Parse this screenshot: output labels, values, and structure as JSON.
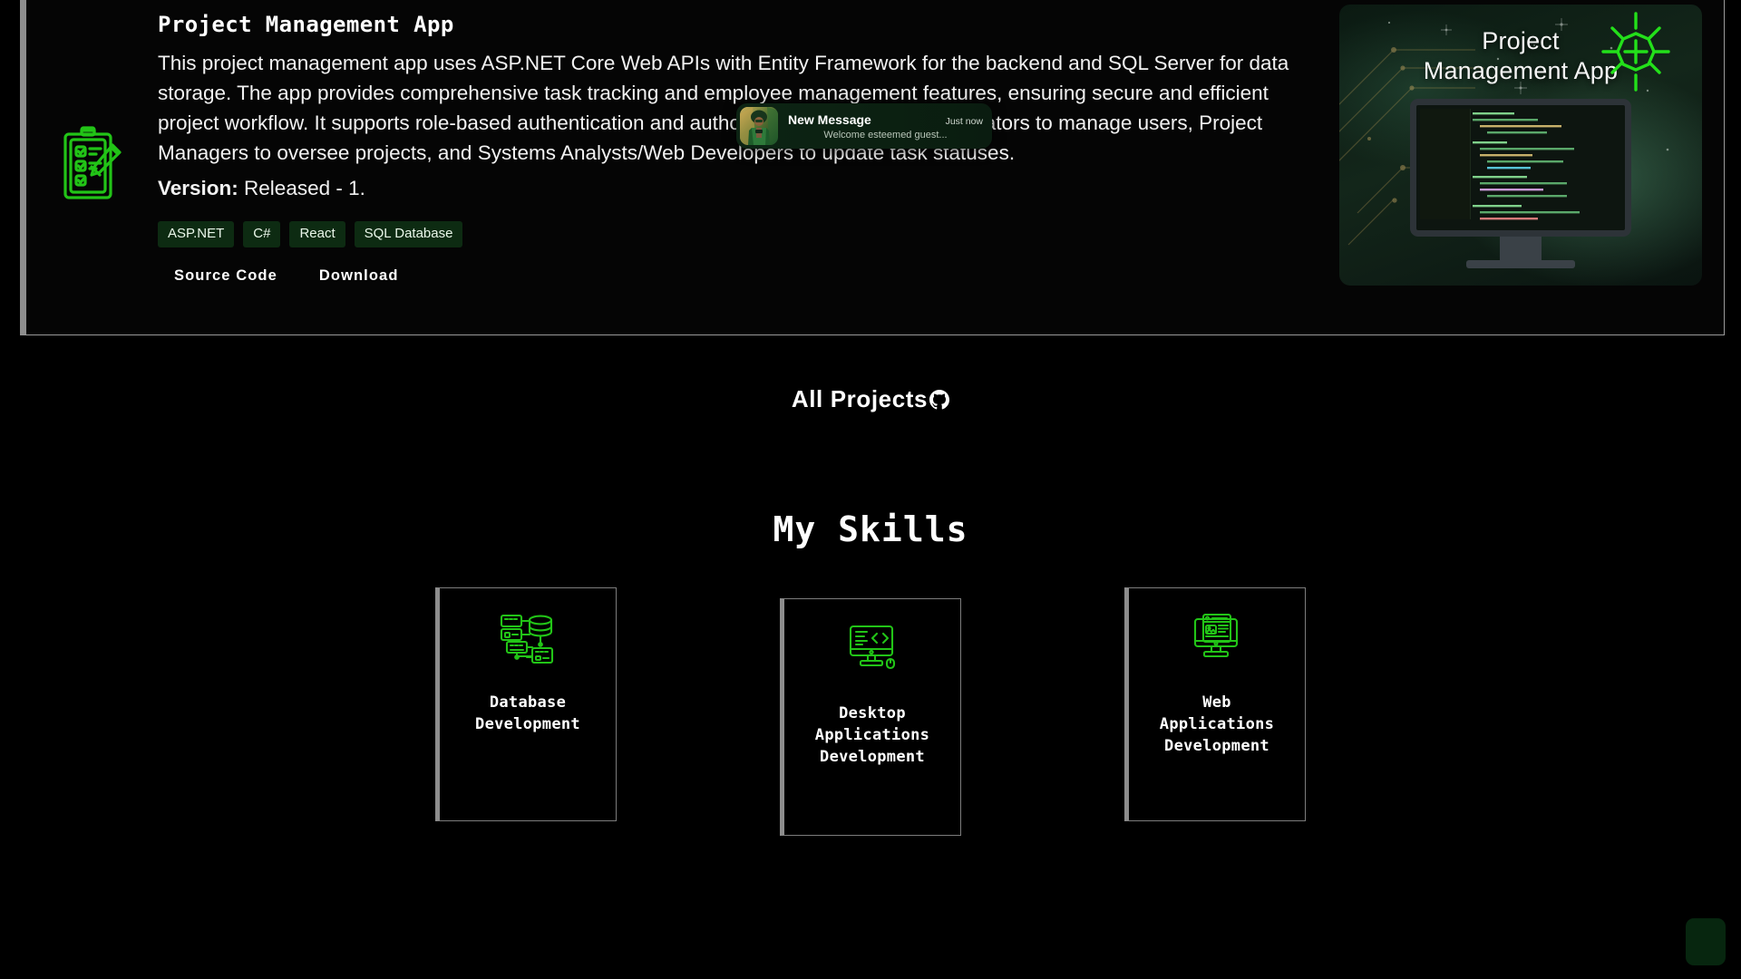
{
  "project": {
    "title": "Project Management App",
    "description": "This project management app uses ASP.NET Core Web APIs with Entity Framework for the backend and SQL Server for data storage. The app provides comprehensive task tracking and employee management features, ensuring secure and efficient project workflow. It supports role-based authentication and authorization, enabling Administrators to manage users, Project Managers to oversee projects, and Systems Analysts/Web Developers to update task statuses.",
    "version_label": "Version:",
    "version_value": "Released - 1.",
    "tags": [
      "ASP.NET",
      "C#",
      "React",
      "SQL Database"
    ],
    "links": [
      {
        "label": "Source Code"
      },
      {
        "label": "Download"
      }
    ],
    "icon_name": "clipboard-checklist-icon",
    "image": {
      "overlay_title_line1": "Project",
      "overlay_title_line2": "Management App",
      "sun_icon_name": "gear-sun-icon",
      "monitor_icon_name": "code-monitor-image"
    }
  },
  "toast": {
    "title": "New Message",
    "time": "Just now",
    "preview": "Welcome esteemed guest...",
    "avatar_name": "sender-avatar"
  },
  "all_projects": {
    "label": "All Projects",
    "icon_name": "github-icon"
  },
  "skills": {
    "heading": "My Skills",
    "cards": [
      {
        "label": "Database\nDevelopment",
        "label_lines": [
          "Database",
          "Development"
        ],
        "icon_name": "database-network-icon"
      },
      {
        "label": "Desktop Applications Development",
        "label_lines": [
          "Desktop",
          "Applications",
          "Development"
        ],
        "icon_name": "desktop-code-icon"
      },
      {
        "label": "Web Applications Development",
        "label_lines": [
          "Web",
          "Applications",
          "Development"
        ],
        "icon_name": "web-browser-icon"
      }
    ]
  },
  "chat_fab": {
    "icon_name": "chat-bubble-icon"
  },
  "colors": {
    "background": "#000000",
    "accent_green": "#22c417",
    "tag_bg": "#0d2b12",
    "toast_bg": "#0d2414",
    "border_gray": "#8d8d8d",
    "text": "#ffffff"
  }
}
